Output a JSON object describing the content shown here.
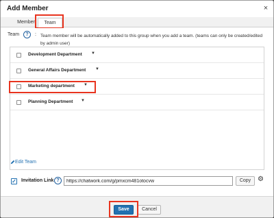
{
  "dialog": {
    "title": "Add Member",
    "close_glyph": "×"
  },
  "tabs": [
    {
      "label": "Member",
      "active": false
    },
    {
      "label": "Team",
      "active": true
    }
  ],
  "team_section": {
    "label": "Team",
    "help_glyph": "?",
    "colon": ":",
    "hint": "Team member will be automatically added to this group when you add a team. (teams can only be created/edited by admin user)"
  },
  "teams": [
    {
      "name": "Development Department",
      "checked": false
    },
    {
      "name": "General Affairs Department",
      "checked": false
    },
    {
      "name": "Marketing department",
      "checked": false
    },
    {
      "name": "Planning Department",
      "checked": false
    }
  ],
  "caret_glyph": "▼",
  "edit_team": {
    "label": "Edit Team",
    "icon": "pencil-icon"
  },
  "invitation": {
    "checked": true,
    "check_glyph": "✓",
    "label": "Invitation Link",
    "help_glyph": "?",
    "url": "https://chatwork.com/g/pmxcm481otocvw",
    "copy_label": "Copy",
    "settings_icon": "gear-icon"
  },
  "footer": {
    "save_label": "Save",
    "cancel_label": "Cancel"
  },
  "colors": {
    "accent": "#2271b1",
    "highlight": "#e8331e"
  }
}
